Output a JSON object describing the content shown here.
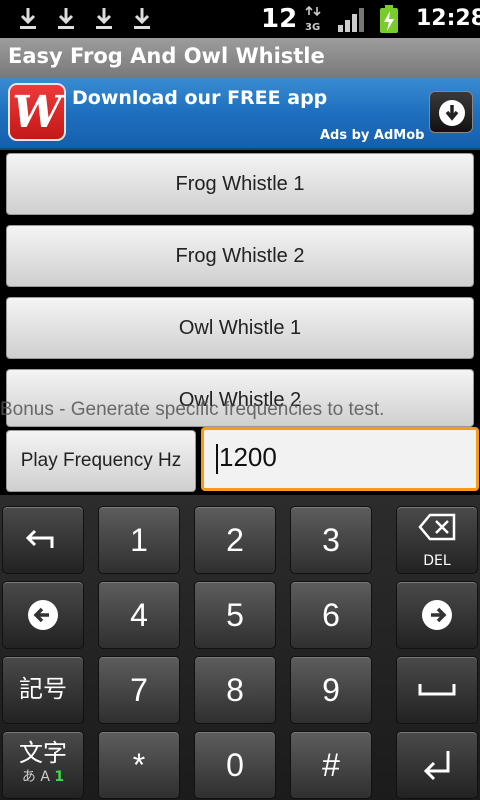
{
  "status_bar": {
    "notification_icons": [
      "download-icon",
      "download-icon",
      "download-icon",
      "download-icon"
    ],
    "badge_number": "12",
    "network": "3G",
    "time": "12:28"
  },
  "title_bar": {
    "title": "Easy Frog And Owl Whistle"
  },
  "ad": {
    "logo_letter": "W",
    "text": "Download our FREE app",
    "attribution": "Ads by AdMob"
  },
  "buttons": {
    "frog1": "Frog Whistle 1",
    "frog2": "Frog Whistle 2",
    "owl1": "Owl Whistle 1",
    "owl2": "Owl Whistle 2"
  },
  "bonus_text": "Bonus - Generate specific frequencies to test.",
  "play_button": "Play Frequency Hz",
  "frequency_input": {
    "value": "1200"
  },
  "keyboard": {
    "digits": [
      "1",
      "2",
      "3",
      "4",
      "5",
      "6",
      "7",
      "8",
      "9",
      "*",
      "0",
      "#"
    ],
    "del_label": "DEL",
    "symbol_key": "記号",
    "mode_key": {
      "main": "文字",
      "sub_prefix": "あ A",
      "sub_num": "1"
    },
    "icons": [
      "undo-icon",
      "backspace-icon",
      "left-arrow-icon",
      "right-arrow-icon",
      "space-icon",
      "enter-icon"
    ]
  }
}
